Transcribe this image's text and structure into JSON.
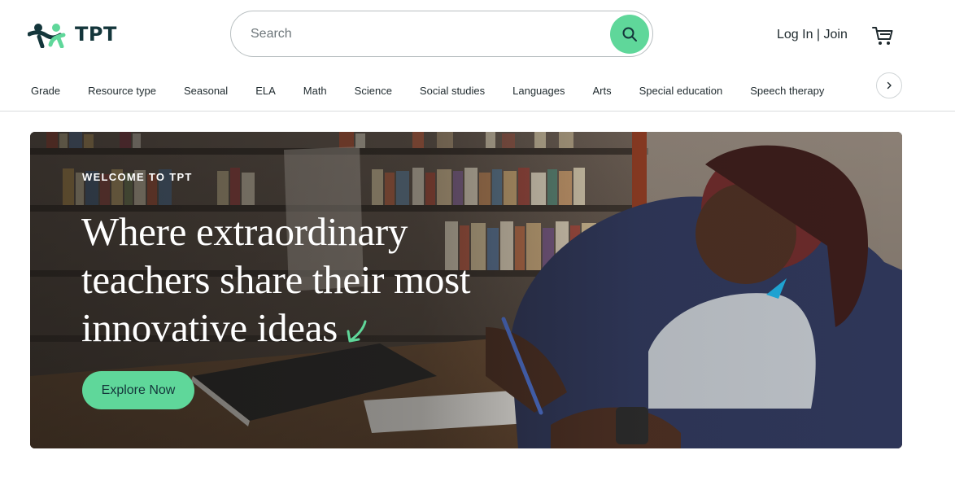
{
  "header": {
    "logo_text": "TPT",
    "search_placeholder": "Search",
    "login_label": "Log In | Join"
  },
  "nav": {
    "categories": [
      "Grade",
      "Resource type",
      "Seasonal",
      "ELA",
      "Math",
      "Science",
      "Social studies",
      "Languages",
      "Arts",
      "Special education",
      "Speech therapy"
    ]
  },
  "hero": {
    "eyebrow": "WELCOME TO TPT",
    "headline_line1": "Where extraordinary",
    "headline_line2": "teachers share their most",
    "headline_line3": "innovative ideas",
    "cta_label": "Explore Now"
  },
  "colors": {
    "accent": "#5fd79a",
    "brand_dark": "#14363b"
  },
  "icons": {
    "search": "search-icon",
    "cart": "cart-icon",
    "next": "chevron-right-icon"
  }
}
